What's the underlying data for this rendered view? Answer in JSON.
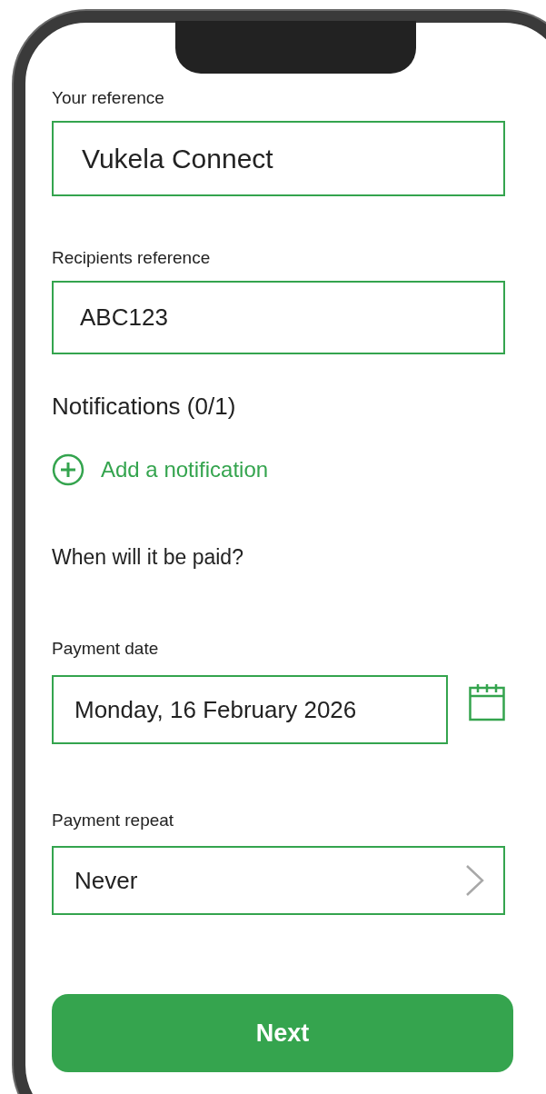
{
  "reference_fields": [
    {
      "kind": "text",
      "label": "Your reference",
      "value": "Vukela Connect"
    },
    {
      "kind": "text",
      "label": "Recipients reference",
      "value": "ABC123"
    }
  ],
  "notifications": {
    "title": "Notifications (0/1)",
    "action": "Add a notification"
  },
  "schedule": {
    "question": "When will it be paid?",
    "fields": [
      {
        "kind": "date",
        "label": "Payment date",
        "value": "Monday, 16 February 2026"
      },
      {
        "kind": "select",
        "label": "Payment repeat",
        "value": "Never"
      }
    ]
  },
  "next_button": "Next"
}
